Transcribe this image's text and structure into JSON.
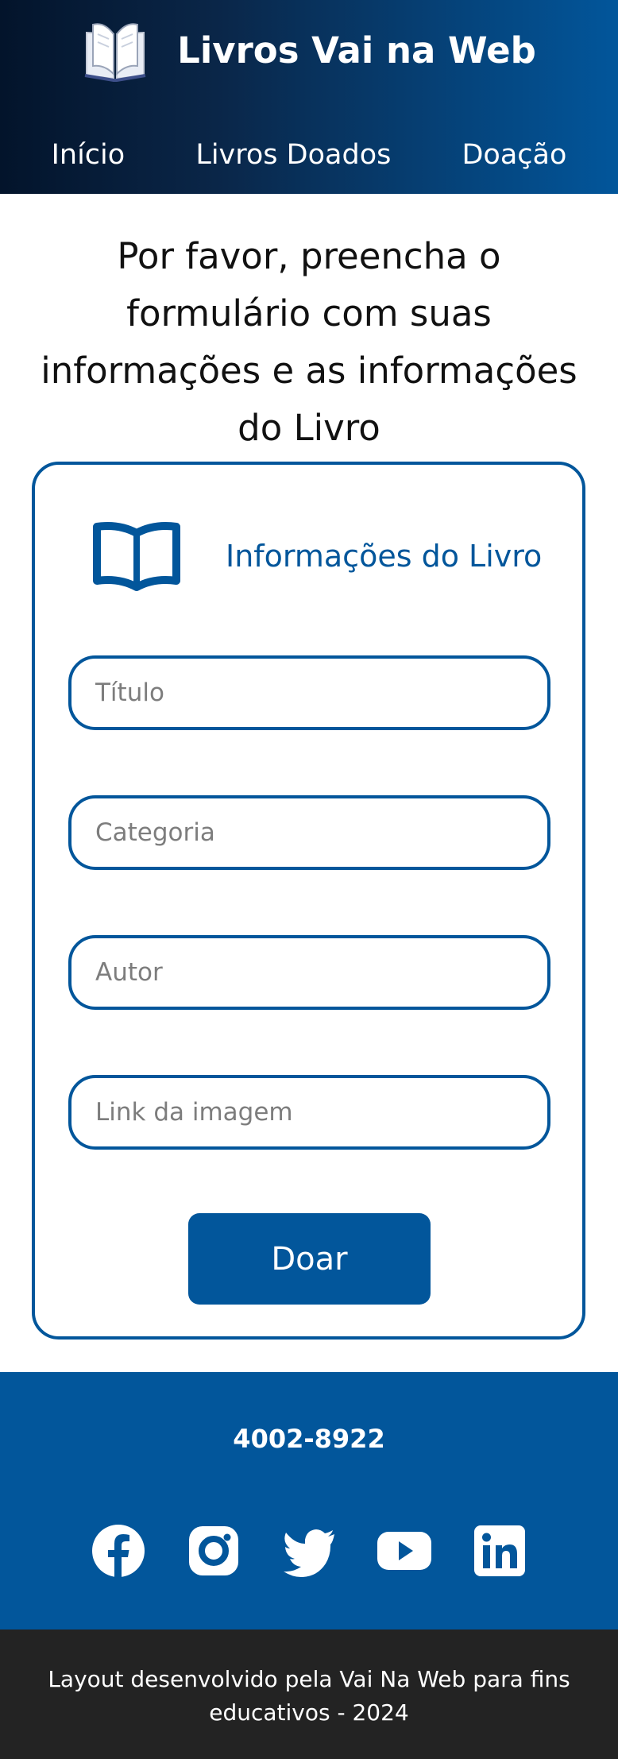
{
  "header": {
    "title": "Livros Vai na Web",
    "logo_icon": "open-book-icon",
    "nav": [
      {
        "label": "Início"
      },
      {
        "label": "Livros Doados"
      },
      {
        "label": "Doação"
      }
    ]
  },
  "intro": {
    "text": "Por favor, preencha o formulário com suas informações e as informações do Livro"
  },
  "form": {
    "heading": "Informações do Livro",
    "heading_icon": "book-icon",
    "fields": [
      {
        "placeholder": "Título",
        "value": ""
      },
      {
        "placeholder": "Categoria",
        "value": ""
      },
      {
        "placeholder": "Autor",
        "value": ""
      },
      {
        "placeholder": "Link da imagem",
        "value": ""
      }
    ],
    "submit_label": "Doar"
  },
  "footer": {
    "phone": "4002-8922",
    "socials": [
      "facebook-icon",
      "instagram-icon",
      "twitter-icon",
      "youtube-icon",
      "linkedin-icon"
    ],
    "credit": "Layout desenvolvido pela Vai Na Web para fins educativos - 2024"
  },
  "colors": {
    "primary": "#02569b",
    "header_dark": "#03142b",
    "bottom_bar": "#232323",
    "text_dark": "#111111"
  }
}
